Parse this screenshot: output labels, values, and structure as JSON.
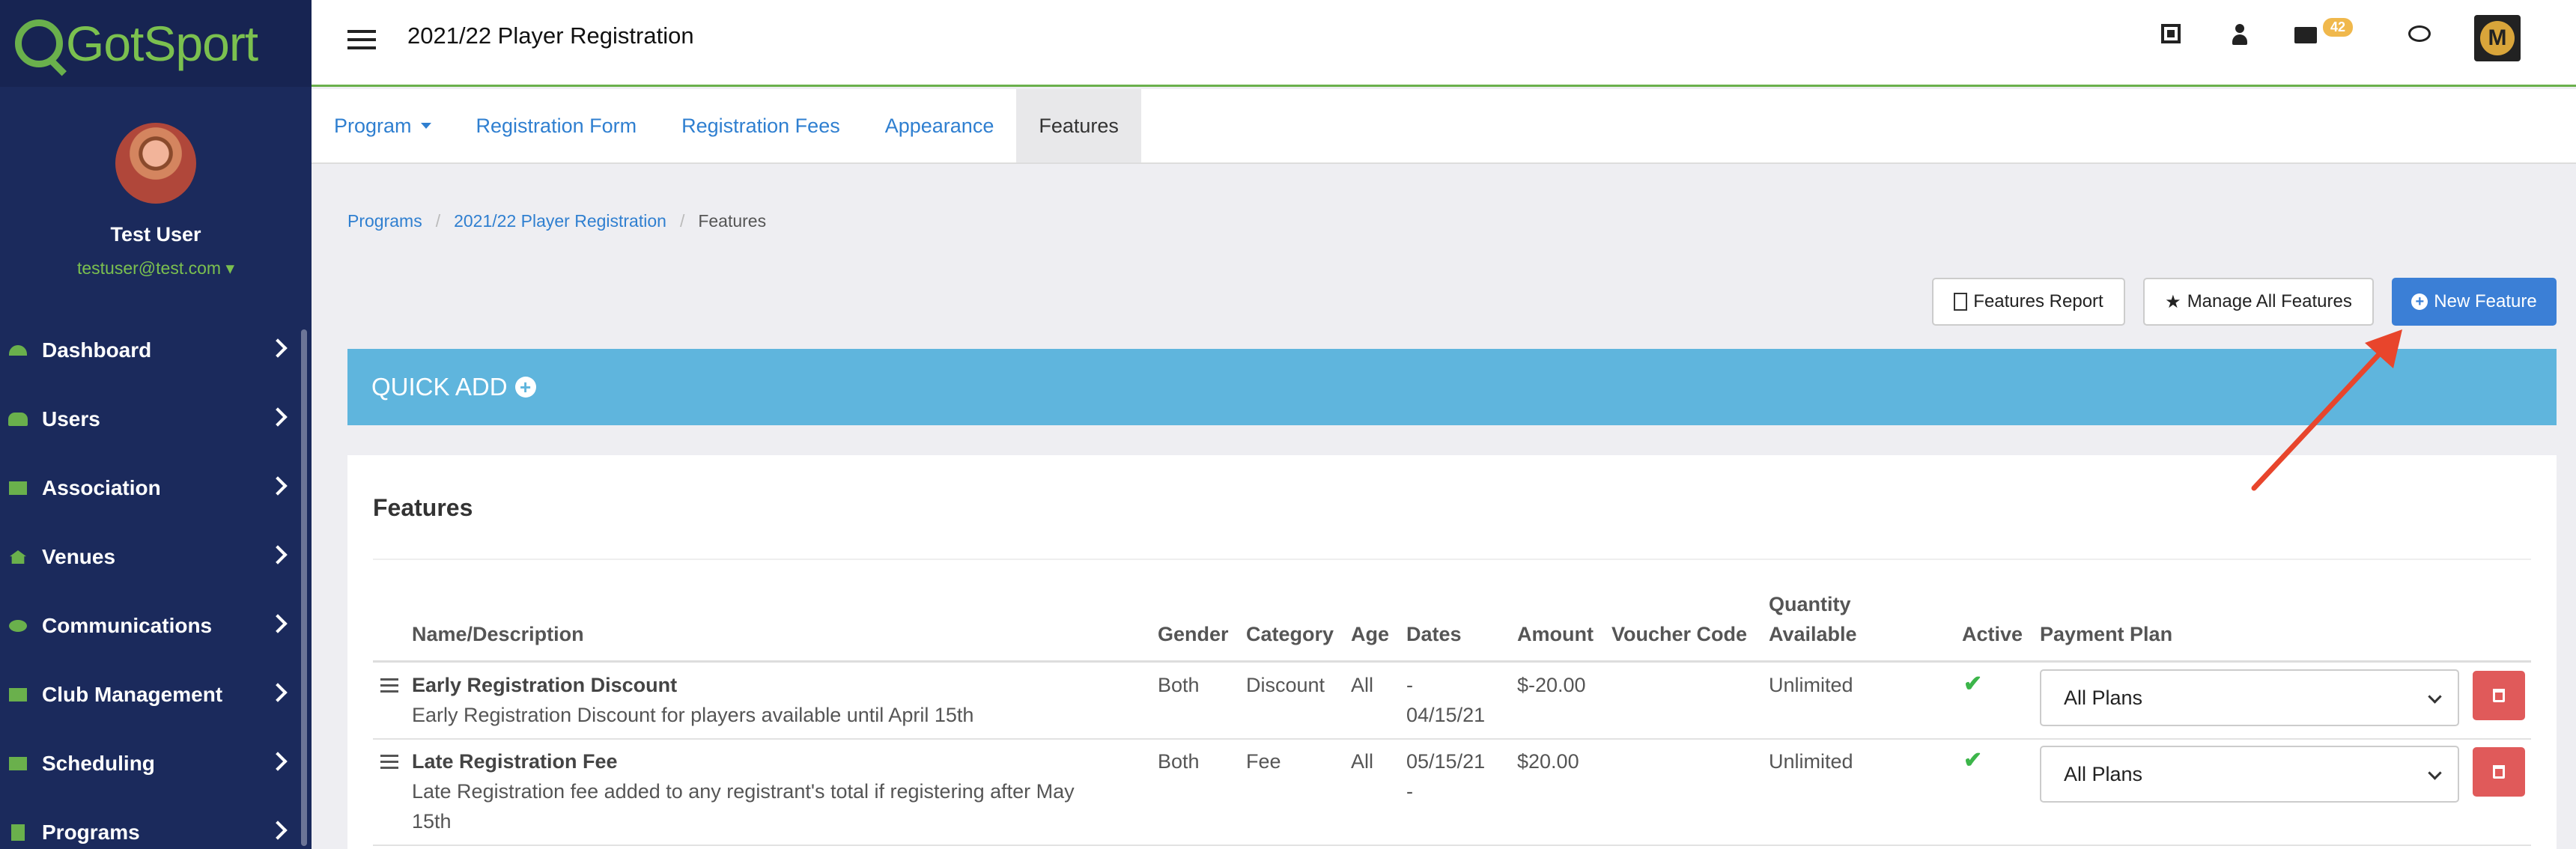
{
  "app": {
    "brand": "GotSport"
  },
  "sidebar": {
    "user_name": "Test User",
    "user_email": "testuser@test.com",
    "items": [
      {
        "label": "Dashboard",
        "icon": "dashboard-icon"
      },
      {
        "label": "Users",
        "icon": "users-icon"
      },
      {
        "label": "Association",
        "icon": "sitemap-icon"
      },
      {
        "label": "Venues",
        "icon": "home-icon"
      },
      {
        "label": "Communications",
        "icon": "comments-icon"
      },
      {
        "label": "Club Management",
        "icon": "club-icon"
      },
      {
        "label": "Scheduling",
        "icon": "calendar-icon"
      },
      {
        "label": "Programs",
        "icon": "file-icon"
      }
    ]
  },
  "header": {
    "title": "2021/22 Player Registration",
    "mail_count": "42",
    "brand_logo_letter": "M"
  },
  "tabs": [
    {
      "label": "Program"
    },
    {
      "label": "Registration Form"
    },
    {
      "label": "Registration Fees"
    },
    {
      "label": "Appearance"
    },
    {
      "label": "Features"
    }
  ],
  "breadcrumb": [
    "Programs",
    "2021/22 Player Registration",
    "Features"
  ],
  "actions": {
    "report": "Features Report",
    "manage": "Manage All Features",
    "new": "New Feature"
  },
  "quick_add": "QUICK ADD",
  "features": {
    "title": "Features",
    "columns": [
      "Name/Description",
      "Gender",
      "Category",
      "Age",
      "Dates",
      "Amount",
      "Voucher Code",
      "Quantity",
      "Available",
      "Active",
      "Payment Plan"
    ],
    "rows": [
      {
        "name": "Early Registration Discount",
        "description": "Early Registration Discount for players available until April 15th",
        "gender": "Both",
        "category": "Discount",
        "age": "All",
        "dates_line1": "-",
        "dates_line2": "04/15/21",
        "amount": "$-20.00",
        "voucher": "",
        "quantity": "Unlimited",
        "plan": "All Plans"
      },
      {
        "name": "Late Registration Fee",
        "description_line1": "Late Registration fee added to any registrant's total if registering after May",
        "description_line2": "15th",
        "gender": "Both",
        "category": "Fee",
        "age": "All",
        "dates_line1": "05/15/21",
        "dates_line2": "-",
        "amount": "$20.00",
        "voucher": "",
        "quantity": "Unlimited",
        "plan": "All Plans"
      }
    ]
  },
  "colors": {
    "sidebar": "#1b2a5c",
    "accent_green": "#6ab04c",
    "link_blue": "#2f7fd0",
    "primary_button": "#3b7fd6",
    "quick_add": "#5fb5dd",
    "danger": "#e05a5a",
    "annotation_arrow": "#e8452c"
  }
}
